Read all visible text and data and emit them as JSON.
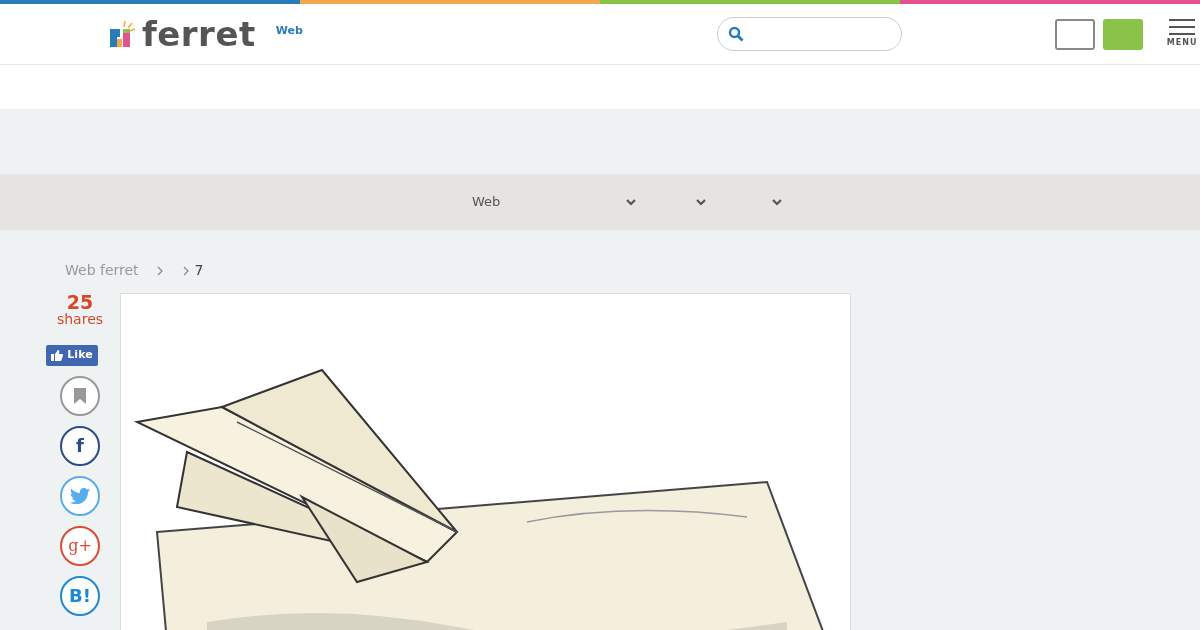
{
  "header": {
    "logo": "ferret",
    "tag": "Web",
    "menu_label": "MENU",
    "buttons": [
      {
        "kind": "outline"
      },
      {
        "kind": "filled"
      }
    ]
  },
  "nav": {
    "items": [
      {
        "label": "Web",
        "dropdown": true
      },
      {
        "dropdown": true
      },
      {
        "dropdown": true
      }
    ]
  },
  "breadcrumb": [
    {
      "label": "Web ferret"
    },
    {
      "kind": "blank"
    },
    {
      "label": "7"
    }
  ],
  "share": {
    "count": "25",
    "unit": "shares",
    "like": "Like",
    "buttons": [
      {
        "kind": "bookmark"
      },
      {
        "kind": "facebook",
        "label": "f"
      },
      {
        "kind": "twitter"
      },
      {
        "kind": "google",
        "label": "g+"
      },
      {
        "kind": "hatena",
        "label": "B!"
      }
    ]
  }
}
